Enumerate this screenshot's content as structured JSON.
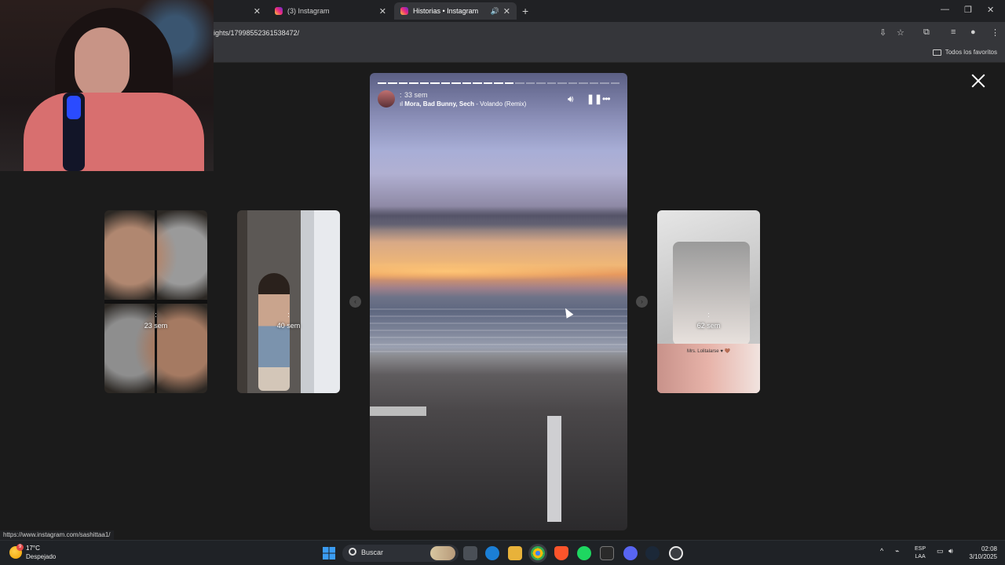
{
  "browser": {
    "tabs": [
      {
        "label": "(3) Instagram"
      },
      {
        "label": "Historias • Instagram"
      }
    ],
    "url": "ights/17998552361538472/",
    "bookmarks_label": "Todos los favoritos",
    "status_url": "https://www.instagram.com/sashittaa1/"
  },
  "story": {
    "user": ":",
    "time": "33 sem",
    "music_artists": "Mora, Bad Bunny, Sech",
    "music_title": " - Volando (Remix)",
    "progress_done": 13,
    "progress_total": 23
  },
  "thumbnails": [
    {
      "user": ":",
      "time": "23 sem"
    },
    {
      "user": ":",
      "time": "40 sem"
    },
    {
      "user": ":",
      "time": "62 sem",
      "caption": "Mrs. Lolitalarse ♥ 🤎"
    }
  ],
  "taskbar": {
    "weather_temp": "17°C",
    "weather_cond": "Despejado",
    "weather_badge": "9",
    "search_label": "Buscar",
    "lang_top": "ESP",
    "lang_bottom": "LAA",
    "time": "02:08",
    "date": "3/10/2025"
  }
}
